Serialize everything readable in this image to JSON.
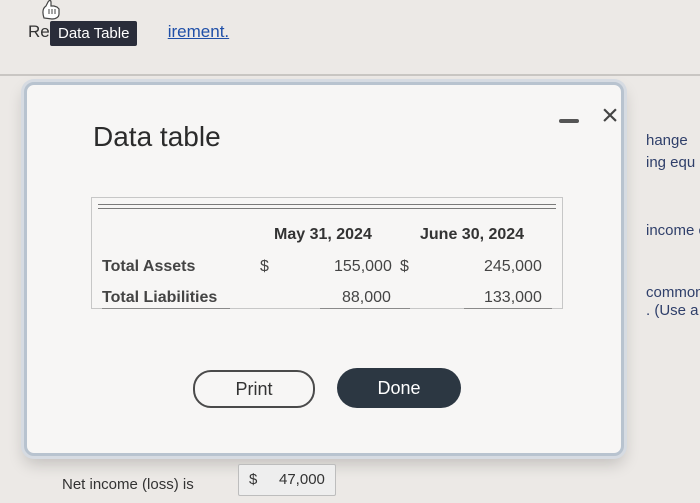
{
  "page": {
    "top_text_prefix": "Re",
    "top_link": "irement.",
    "tooltip": "Data Table",
    "right_snippets": [
      "hange",
      "ing equ",
      "income c",
      "common",
      ". (Use a r"
    ]
  },
  "modal": {
    "title": "Data table",
    "columns": [
      "May 31, 2024",
      "June 30, 2024"
    ],
    "rows": [
      {
        "label": "Total Assets",
        "dollar1": "$",
        "v1": "155,000",
        "dollar2": "$",
        "v2": "245,000"
      },
      {
        "label": "Total Liabilities",
        "dollar1": "",
        "v1": "88,000",
        "dollar2": "",
        "v2": "133,000"
      }
    ],
    "print_label": "Print",
    "done_label": "Done"
  },
  "bottom": {
    "label": "Net income (loss) is",
    "currency": "$",
    "value": "47,000"
  }
}
